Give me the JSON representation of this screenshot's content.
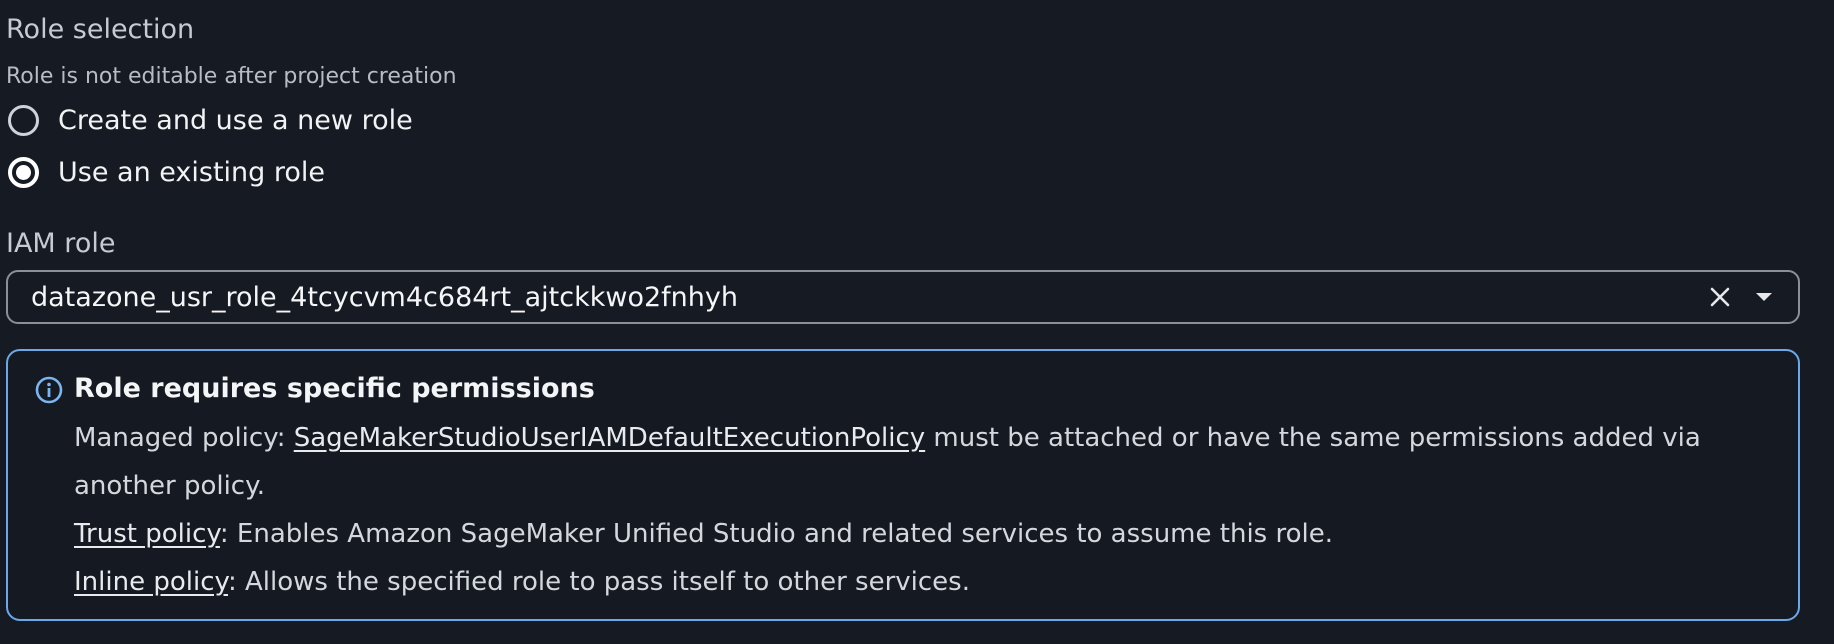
{
  "role_selection": {
    "title": "Role selection",
    "description": "Role is not editable after project creation",
    "options": [
      {
        "label": "Create and use a new role",
        "checked": false
      },
      {
        "label": "Use an existing role",
        "checked": true
      }
    ]
  },
  "iam_role": {
    "label": "IAM role",
    "value": "datazone_usr_role_4tcycvm4c684rt_ajtckkwo2fnhyh",
    "clear_icon": "close-icon",
    "dropdown_icon": "caret-down-icon"
  },
  "info": {
    "icon": "info-icon",
    "title": "Role requires specific permissions",
    "managed_prefix": "Managed policy: ",
    "managed_link": "SageMakerStudioUserIAMDefaultExecutionPolicy",
    "managed_suffix": " must be attached or have the same permissions added via another policy.",
    "trust_link": "Trust policy",
    "trust_suffix": ": Enables Amazon SageMaker Unified Studio and related services to assume this role.",
    "inline_link": "Inline policy",
    "inline_suffix": ": Allows the specified role to pass itself to other services."
  },
  "colors": {
    "background": "#161a22",
    "info_border": "#6aa8ea",
    "input_border": "#8a9099"
  }
}
